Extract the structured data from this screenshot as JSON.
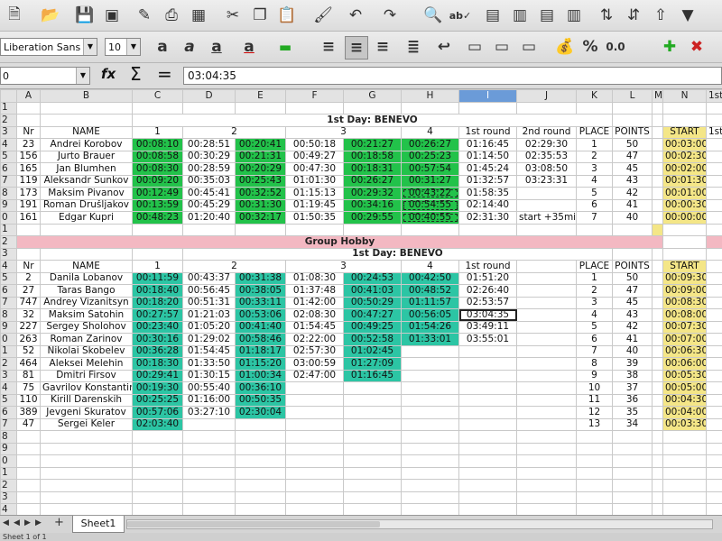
{
  "toolbar": {
    "font_name": "Liberation Sans",
    "font_size": "10",
    "percent_label": "%",
    "number_label": "0.0"
  },
  "formula_bar": {
    "name_box": "0",
    "function_wizard": "fx",
    "sum_symbol": "Σ",
    "equals_symbol": "=",
    "content": "03:04:35"
  },
  "columns": [
    "A",
    "B",
    "C",
    "D",
    "E",
    "F",
    "G",
    "H",
    "I",
    "J",
    "K",
    "L",
    "M",
    "N",
    "1st"
  ],
  "sheet": {
    "row_numbers": [
      "1",
      "2",
      "3",
      "4",
      "5",
      "6",
      "7",
      "8",
      "9",
      "0",
      "1",
      "2",
      "3",
      "4",
      "5",
      "6",
      "7",
      "8",
      "9",
      "0",
      "1",
      "2",
      "3",
      "4",
      "5",
      "6",
      "7",
      "8",
      "9",
      "0",
      "1",
      "2",
      "3",
      "4",
      "5",
      "6"
    ],
    "section1": {
      "title": "1st Day: BENEVO",
      "headers": {
        "nr": "Nr",
        "name": "NAME",
        "c1": "1",
        "c2": "2",
        "c3": "3",
        "c4": "4",
        "r1": "1st round",
        "r2": "2nd round",
        "place": "PLACE",
        "points": "POINTS",
        "start": "START",
        "next": "1st"
      },
      "rows": [
        {
          "nr": "23",
          "name": "Andrei Korobov",
          "c1": "00:08:10",
          "c2a": "00:28:51",
          "c2b": "00:20:41",
          "c3a": "00:50:18",
          "c3b": "00:21:27",
          "c4": "00:26:27",
          "r1": "01:16:45",
          "r2": "02:29:30",
          "place": "1",
          "points": "50",
          "start": "00:03:00"
        },
        {
          "nr": "156",
          "name": "Jurto Brauer",
          "c1": "00:08:58",
          "c2a": "00:30:29",
          "c2b": "00:21:31",
          "c3a": "00:49:27",
          "c3b": "00:18:58",
          "c4": "00:25:23",
          "r1": "01:14:50",
          "r2": "02:35:53",
          "place": "2",
          "points": "47",
          "start": "00:02:30"
        },
        {
          "nr": "165",
          "name": "Jan Blumhen",
          "c1": "00:08:30",
          "c2a": "00:28:59",
          "c2b": "00:20:29",
          "c3a": "00:47:30",
          "c3b": "00:18:31",
          "c4": "00:57:54",
          "r1": "01:45:24",
          "r2": "03:08:50",
          "place": "3",
          "points": "45",
          "start": "00:02:00"
        },
        {
          "nr": "119",
          "name": "Aleksandr Sunkov",
          "c1": "00:09:20",
          "c2a": "00:35:03",
          "c2b": "00:25:43",
          "c3a": "01:01:30",
          "c3b": "00:26:27",
          "c4": "00:31:27",
          "r1": "01:32:57",
          "r2": "03:23:31",
          "place": "4",
          "points": "43",
          "start": "00:01:30"
        },
        {
          "nr": "173",
          "name": "Maksim Pivanov",
          "c1": "00:12:49",
          "c2a": "00:45:41",
          "c2b": "00:32:52",
          "c3a": "01:15:13",
          "c3b": "00:29:32",
          "c4": "00:43:22",
          "r1": "01:58:35",
          "r2": "",
          "place": "5",
          "points": "42",
          "start": "00:01:00"
        },
        {
          "nr": "191",
          "name": "Roman Drušljakov",
          "c1": "00:13:59",
          "c2a": "00:45:29",
          "c2b": "00:31:30",
          "c3a": "01:19:45",
          "c3b": "00:34:16",
          "c4": "00:54:55",
          "r1": "02:14:40",
          "r2": "",
          "place": "6",
          "points": "41",
          "start": "00:00:30"
        },
        {
          "nr": "161",
          "name": "Edgar Kupri",
          "c1": "00:48:23",
          "c2a": "01:20:40",
          "c2b": "00:32:17",
          "c3a": "01:50:35",
          "c3b": "00:29:55",
          "c4": "00:40:55",
          "r1": "02:31:30",
          "r2": "start +35min",
          "place": "7",
          "points": "40",
          "start": "00:00:00"
        }
      ]
    },
    "group_banner": "Group Hobby",
    "section2": {
      "title": "1st Day: BENEVO",
      "headers": {
        "nr": "Nr",
        "name": "NAME",
        "c1": "1",
        "c2": "2",
        "c3": "3",
        "c4": "4",
        "r1": "1st round",
        "place": "PLACE",
        "points": "POINTS",
        "start": "START"
      },
      "rows": [
        {
          "nr": "2",
          "name": "Danila Lobanov",
          "c1": "00:11:59",
          "c2a": "00:43:37",
          "c2b": "00:31:38",
          "c3a": "01:08:30",
          "c3b": "00:24:53",
          "c4": "00:42:50",
          "r1": "01:51:20",
          "place": "1",
          "points": "50",
          "start": "00:09:30"
        },
        {
          "nr": "27",
          "name": "Taras Bango",
          "c1": "00:18:40",
          "c2a": "00:56:45",
          "c2b": "00:38:05",
          "c3a": "01:37:48",
          "c3b": "00:41:03",
          "c4": "00:48:52",
          "r1": "02:26:40",
          "place": "2",
          "points": "47",
          "start": "00:09:00"
        },
        {
          "nr": "747",
          "name": "Andrey Vizanitsyn",
          "c1": "00:18:20",
          "c2a": "00:51:31",
          "c2b": "00:33:11",
          "c3a": "01:42:00",
          "c3b": "00:50:29",
          "c4": "01:11:57",
          "r1": "02:53:57",
          "place": "3",
          "points": "45",
          "start": "00:08:30"
        },
        {
          "nr": "32",
          "name": "Maksim Šatohin",
          "c1": "00:27:57",
          "c2a": "01:21:03",
          "c2b": "00:53:06",
          "c3a": "02:08:30",
          "c3b": "00:47:27",
          "c4": "00:56:05",
          "r1": "03:04:35",
          "place": "4",
          "points": "43",
          "start": "00:08:00"
        },
        {
          "nr": "227",
          "name": "Sergey Sholohov",
          "c1": "00:23:40",
          "c2a": "01:05:20",
          "c2b": "00:41:40",
          "c3a": "01:54:45",
          "c3b": "00:49:25",
          "c4": "01:54:26",
          "r1": "03:49:11",
          "place": "5",
          "points": "42",
          "start": "00:07:30"
        },
        {
          "nr": "263",
          "name": "Roman Zarinov",
          "c1": "00:30:16",
          "c2a": "01:29:02",
          "c2b": "00:58:46",
          "c3a": "02:22:00",
          "c3b": "00:52:58",
          "c4": "01:33:01",
          "r1": "03:55:01",
          "place": "6",
          "points": "41",
          "start": "00:07:00"
        },
        {
          "nr": "52",
          "name": "Nikolai Skobelev",
          "c1": "00:36:28",
          "c2a": "01:54:45",
          "c2b": "01:18:17",
          "c3a": "02:57:30",
          "c3b": "01:02:45",
          "c4": "",
          "r1": "",
          "place": "7",
          "points": "40",
          "start": "00:06:30"
        },
        {
          "nr": "464",
          "name": "Aleksei Melehin",
          "c1": "00:18:30",
          "c2a": "01:33:50",
          "c2b": "01:15:20",
          "c3a": "03:00:59",
          "c3b": "01:27:09",
          "c4": "",
          "r1": "",
          "place": "8",
          "points": "39",
          "start": "00:06:00"
        },
        {
          "nr": "81",
          "name": "Dmitri Firsov",
          "c1": "00:29:41",
          "c2a": "01:30:15",
          "c2b": "01:00:34",
          "c3a": "02:47:00",
          "c3b": "01:16:45",
          "c4": "",
          "r1": "",
          "place": "9",
          "points": "38",
          "start": "00:05:30"
        },
        {
          "nr": "75",
          "name": "Gavrilov Konstantin",
          "c1": "00:19:30",
          "c2a": "00:55:40",
          "c2b": "00:36:10",
          "c3a": "",
          "c3b": "",
          "c4": "",
          "r1": "",
          "place": "10",
          "points": "37",
          "start": "00:05:00"
        },
        {
          "nr": "110",
          "name": "Kirill Darenskih",
          "c1": "00:25:25",
          "c2a": "01:16:00",
          "c2b": "00:50:35",
          "c3a": "",
          "c3b": "",
          "c4": "",
          "r1": "",
          "place": "11",
          "points": "36",
          "start": "00:04:30"
        },
        {
          "nr": "389",
          "name": "Jevgeni Skuratov",
          "c1": "00:57:06",
          "c2a": "03:27:10",
          "c2b": "02:30:04",
          "c3a": "",
          "c3b": "",
          "c4": "",
          "r1": "",
          "place": "12",
          "points": "35",
          "start": "00:04:00"
        },
        {
          "nr": "47",
          "name": "Sergei Keler",
          "c1": "02:03:40",
          "c2a": "",
          "c2b": "",
          "c3a": "",
          "c3b": "",
          "c4": "",
          "r1": "",
          "place": "13",
          "points": "34",
          "start": "00:03:30"
        }
      ]
    }
  },
  "tabs": {
    "sheet1": "Sheet1"
  },
  "status": {
    "text": "Sheet 1 of 1"
  },
  "colors": {
    "green_time": "#22c24a",
    "teal_time": "#2cc5a4",
    "start_yellow": "#f4e687",
    "banner_pink": "#f3b8c2",
    "selected_col": "#6b9bd8"
  }
}
